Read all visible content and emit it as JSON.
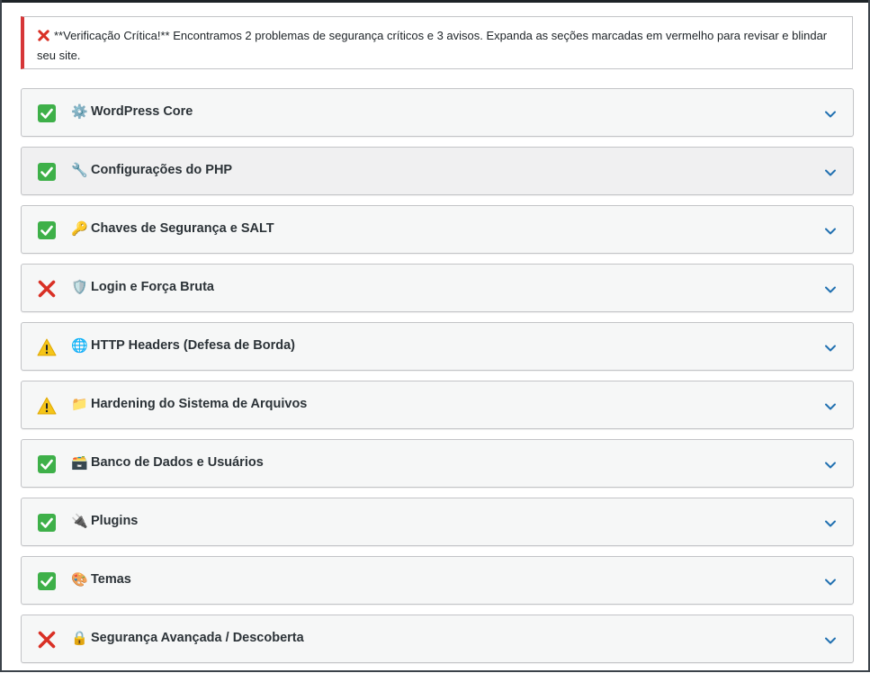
{
  "notice": {
    "text": "**Verificação Crítica!** Encontramos 2 problemas de segurança críticos e 3 avisos. Expanda as seções marcadas em vermelho para revisar e blindar seu site.",
    "color": "#d63638"
  },
  "colors": {
    "pass": "#3eb049",
    "fail": "#d93025",
    "warn": "#f5c518",
    "chevron": "#2271b1"
  },
  "sections": [
    {
      "status": "pass",
      "icon": "gear-icon",
      "glyph": "⚙️",
      "title": "WordPress Core"
    },
    {
      "status": "pass",
      "icon": "wrench-icon",
      "glyph": "🔧",
      "title": "Configurações do PHP"
    },
    {
      "status": "pass",
      "icon": "key-icon",
      "glyph": "🔑",
      "title": "Chaves de Segurança e SALT"
    },
    {
      "status": "fail",
      "icon": "shield-icon",
      "glyph": "🛡️",
      "title": "Login e Força Bruta"
    },
    {
      "status": "warn",
      "icon": "globe-icon",
      "glyph": "🌐",
      "title": "HTTP Headers (Defesa de Borda)"
    },
    {
      "status": "warn",
      "icon": "folder-icon",
      "glyph": "📁",
      "title": "Hardening do Sistema de Arquivos"
    },
    {
      "status": "pass",
      "icon": "card-file-box-icon",
      "glyph": "🗃️",
      "title": "Banco de Dados e Usuários"
    },
    {
      "status": "pass",
      "icon": "plug-icon",
      "glyph": "🔌",
      "title": "Plugins"
    },
    {
      "status": "pass",
      "icon": "palette-icon",
      "glyph": "🎨",
      "title": "Temas"
    },
    {
      "status": "fail",
      "icon": "lock-icon",
      "glyph": "🔒",
      "title": "Segurança Avançada / Descoberta"
    }
  ]
}
